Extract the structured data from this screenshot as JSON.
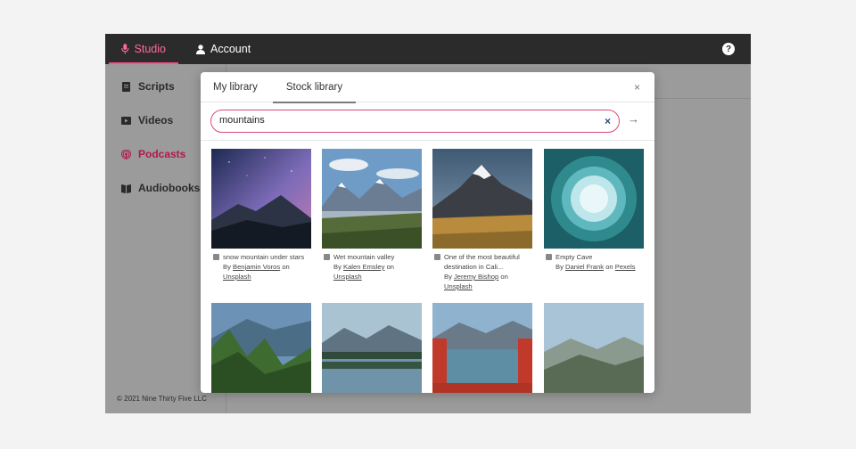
{
  "topbar": {
    "tabs": [
      {
        "label": "Studio",
        "icon": "microphone-icon"
      },
      {
        "label": "Account",
        "icon": "user-icon"
      }
    ],
    "help_icon": "question-icon",
    "help_glyph": "?"
  },
  "sidebar": {
    "items": [
      {
        "label": "Scripts",
        "icon": "document-icon"
      },
      {
        "label": "Videos",
        "icon": "play-icon"
      },
      {
        "label": "Podcasts",
        "icon": "podcast-icon"
      },
      {
        "label": "Audiobooks",
        "icon": "book-icon"
      }
    ],
    "footer": "© 2021 Nine Thirty Five LLC"
  },
  "modal": {
    "tabs": [
      "My library",
      "Stock library"
    ],
    "close_glyph": "×",
    "search": {
      "value": "mountains",
      "clear_glyph": "×",
      "go_glyph": "→"
    },
    "results": [
      {
        "title": "snow mountain under stars",
        "by": "By",
        "author": "Benjamin Voros",
        "on": "on",
        "source": "Unsplash"
      },
      {
        "title": "Wet mountain valley",
        "by": "By",
        "author": "Kalen Emsley",
        "on": "on",
        "source": "Unsplash"
      },
      {
        "title": "One of the most beautiful destination in Cali...",
        "by": "By",
        "author": "Jeremy Bishop",
        "on": "on",
        "source": "Unsplash"
      },
      {
        "title": "Empty Cave",
        "by": "By",
        "author": "Daniel Frank",
        "on": "on",
        "source": "Pexels"
      }
    ]
  },
  "colors": {
    "accent": "#ff4f86",
    "active_sidebar": "#b0194d",
    "topbar": "#2b2b2b"
  }
}
